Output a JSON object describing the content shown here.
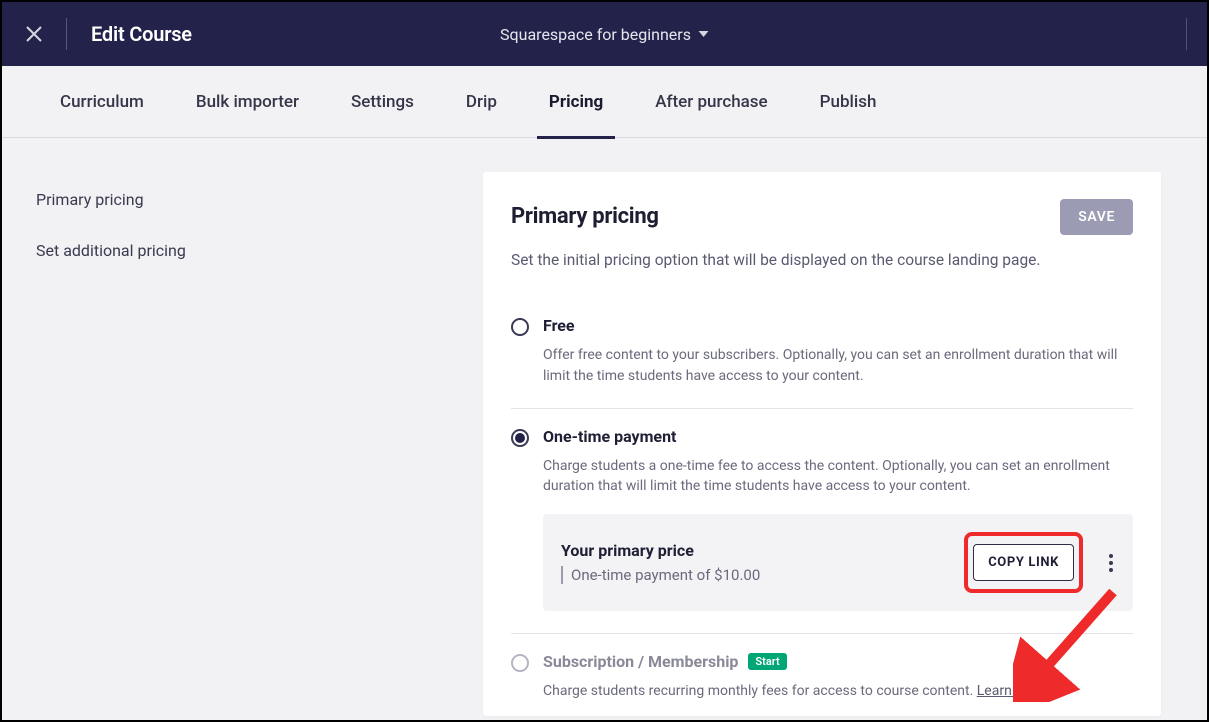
{
  "header": {
    "title": "Edit Course",
    "course_name": "Squarespace for beginners"
  },
  "tabs": [
    {
      "label": "Curriculum"
    },
    {
      "label": "Bulk importer"
    },
    {
      "label": "Settings"
    },
    {
      "label": "Drip"
    },
    {
      "label": "Pricing",
      "active": true
    },
    {
      "label": "After purchase"
    },
    {
      "label": "Publish"
    }
  ],
  "sidebar": {
    "items": [
      {
        "label": "Primary pricing"
      },
      {
        "label": "Set additional pricing"
      }
    ]
  },
  "panel": {
    "title": "Primary pricing",
    "save_label": "SAVE",
    "subtitle": "Set the initial pricing option that will be displayed on the course landing page.",
    "options": {
      "free": {
        "title": "Free",
        "desc": "Offer free content to your subscribers. Optionally, you can set an enrollment duration that will limit the time students have access to your content."
      },
      "onetime": {
        "title": "One-time payment",
        "desc": "Charge students a one-time fee to access the content. Optionally, you can set an enrollment duration that will limit the time students have access to your content.",
        "card": {
          "title": "Your primary price",
          "subtitle": "One-time payment of $10.00",
          "copy_label": "COPY LINK"
        }
      },
      "subscription": {
        "title": "Subscription / Membership",
        "badge": "Start",
        "desc": "Charge students recurring monthly fees for access to course content. ",
        "learn_more": "Learn more"
      }
    }
  }
}
